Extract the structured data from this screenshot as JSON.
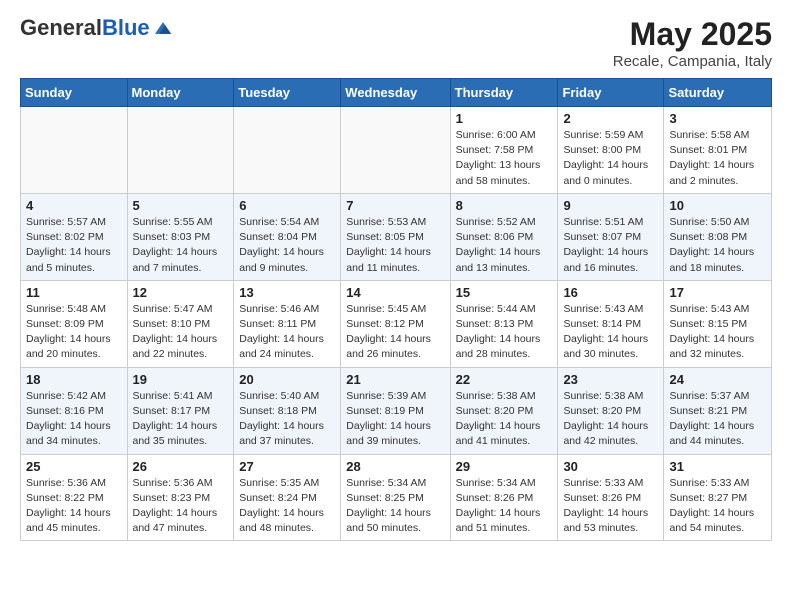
{
  "header": {
    "logo_general": "General",
    "logo_blue": "Blue",
    "main_title": "May 2025",
    "subtitle": "Recale, Campania, Italy"
  },
  "calendar": {
    "days_of_week": [
      "Sunday",
      "Monday",
      "Tuesday",
      "Wednesday",
      "Thursday",
      "Friday",
      "Saturday"
    ],
    "weeks": [
      [
        {
          "day": "",
          "info": ""
        },
        {
          "day": "",
          "info": ""
        },
        {
          "day": "",
          "info": ""
        },
        {
          "day": "",
          "info": ""
        },
        {
          "day": "1",
          "info": "Sunrise: 6:00 AM\nSunset: 7:58 PM\nDaylight: 13 hours and 58 minutes."
        },
        {
          "day": "2",
          "info": "Sunrise: 5:59 AM\nSunset: 8:00 PM\nDaylight: 14 hours and 0 minutes."
        },
        {
          "day": "3",
          "info": "Sunrise: 5:58 AM\nSunset: 8:01 PM\nDaylight: 14 hours and 2 minutes."
        }
      ],
      [
        {
          "day": "4",
          "info": "Sunrise: 5:57 AM\nSunset: 8:02 PM\nDaylight: 14 hours and 5 minutes."
        },
        {
          "day": "5",
          "info": "Sunrise: 5:55 AM\nSunset: 8:03 PM\nDaylight: 14 hours and 7 minutes."
        },
        {
          "day": "6",
          "info": "Sunrise: 5:54 AM\nSunset: 8:04 PM\nDaylight: 14 hours and 9 minutes."
        },
        {
          "day": "7",
          "info": "Sunrise: 5:53 AM\nSunset: 8:05 PM\nDaylight: 14 hours and 11 minutes."
        },
        {
          "day": "8",
          "info": "Sunrise: 5:52 AM\nSunset: 8:06 PM\nDaylight: 14 hours and 13 minutes."
        },
        {
          "day": "9",
          "info": "Sunrise: 5:51 AM\nSunset: 8:07 PM\nDaylight: 14 hours and 16 minutes."
        },
        {
          "day": "10",
          "info": "Sunrise: 5:50 AM\nSunset: 8:08 PM\nDaylight: 14 hours and 18 minutes."
        }
      ],
      [
        {
          "day": "11",
          "info": "Sunrise: 5:48 AM\nSunset: 8:09 PM\nDaylight: 14 hours and 20 minutes."
        },
        {
          "day": "12",
          "info": "Sunrise: 5:47 AM\nSunset: 8:10 PM\nDaylight: 14 hours and 22 minutes."
        },
        {
          "day": "13",
          "info": "Sunrise: 5:46 AM\nSunset: 8:11 PM\nDaylight: 14 hours and 24 minutes."
        },
        {
          "day": "14",
          "info": "Sunrise: 5:45 AM\nSunset: 8:12 PM\nDaylight: 14 hours and 26 minutes."
        },
        {
          "day": "15",
          "info": "Sunrise: 5:44 AM\nSunset: 8:13 PM\nDaylight: 14 hours and 28 minutes."
        },
        {
          "day": "16",
          "info": "Sunrise: 5:43 AM\nSunset: 8:14 PM\nDaylight: 14 hours and 30 minutes."
        },
        {
          "day": "17",
          "info": "Sunrise: 5:43 AM\nSunset: 8:15 PM\nDaylight: 14 hours and 32 minutes."
        }
      ],
      [
        {
          "day": "18",
          "info": "Sunrise: 5:42 AM\nSunset: 8:16 PM\nDaylight: 14 hours and 34 minutes."
        },
        {
          "day": "19",
          "info": "Sunrise: 5:41 AM\nSunset: 8:17 PM\nDaylight: 14 hours and 35 minutes."
        },
        {
          "day": "20",
          "info": "Sunrise: 5:40 AM\nSunset: 8:18 PM\nDaylight: 14 hours and 37 minutes."
        },
        {
          "day": "21",
          "info": "Sunrise: 5:39 AM\nSunset: 8:19 PM\nDaylight: 14 hours and 39 minutes."
        },
        {
          "day": "22",
          "info": "Sunrise: 5:38 AM\nSunset: 8:20 PM\nDaylight: 14 hours and 41 minutes."
        },
        {
          "day": "23",
          "info": "Sunrise: 5:38 AM\nSunset: 8:20 PM\nDaylight: 14 hours and 42 minutes."
        },
        {
          "day": "24",
          "info": "Sunrise: 5:37 AM\nSunset: 8:21 PM\nDaylight: 14 hours and 44 minutes."
        }
      ],
      [
        {
          "day": "25",
          "info": "Sunrise: 5:36 AM\nSunset: 8:22 PM\nDaylight: 14 hours and 45 minutes."
        },
        {
          "day": "26",
          "info": "Sunrise: 5:36 AM\nSunset: 8:23 PM\nDaylight: 14 hours and 47 minutes."
        },
        {
          "day": "27",
          "info": "Sunrise: 5:35 AM\nSunset: 8:24 PM\nDaylight: 14 hours and 48 minutes."
        },
        {
          "day": "28",
          "info": "Sunrise: 5:34 AM\nSunset: 8:25 PM\nDaylight: 14 hours and 50 minutes."
        },
        {
          "day": "29",
          "info": "Sunrise: 5:34 AM\nSunset: 8:26 PM\nDaylight: 14 hours and 51 minutes."
        },
        {
          "day": "30",
          "info": "Sunrise: 5:33 AM\nSunset: 8:26 PM\nDaylight: 14 hours and 53 minutes."
        },
        {
          "day": "31",
          "info": "Sunrise: 5:33 AM\nSunset: 8:27 PM\nDaylight: 14 hours and 54 minutes."
        }
      ]
    ]
  }
}
